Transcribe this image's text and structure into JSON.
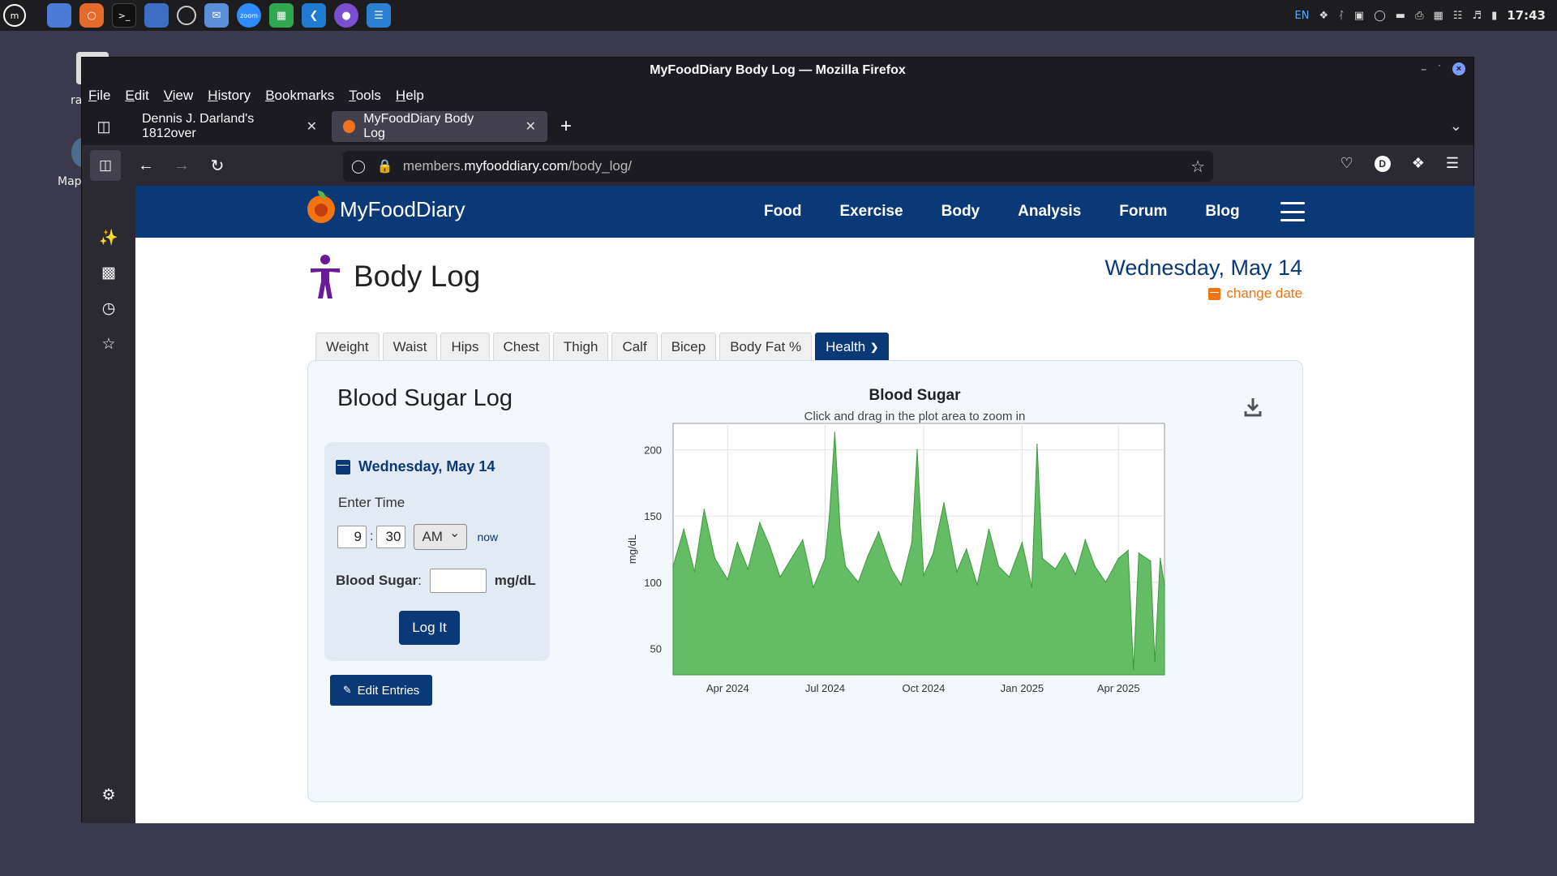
{
  "system_panel": {
    "launcher_icons": [
      "mint-menu-icon",
      "files-icon",
      "firefox-icon",
      "terminal-icon",
      "finder-icon",
      "timeshift-icon",
      "mail-icon",
      "zoom-icon",
      "spreadsheet-icon",
      "vscode-icon",
      "github-icon",
      "notes-icon"
    ],
    "lang": "EN",
    "clock": "17:43"
  },
  "desktop": {
    "item1_label": "ra",
    "item2_label": "Map"
  },
  "window": {
    "title": "MyFoodDiary Body Log — Mozilla Firefox"
  },
  "menu": [
    "File",
    "Edit",
    "View",
    "History",
    "Bookmarks",
    "Tools",
    "Help"
  ],
  "tabs": [
    {
      "label": "Dennis J. Darland's 1812over",
      "active": false
    },
    {
      "label": "MyFoodDiary Body Log",
      "active": true
    }
  ],
  "url": {
    "prefix": "members.",
    "host": "myfooddiary.com",
    "path": "/body_log/"
  },
  "account_initial": "D",
  "site": {
    "logo_text": "MyFoodDiary",
    "nav": [
      "Food",
      "Exercise",
      "Body",
      "Analysis",
      "Forum",
      "Blog"
    ]
  },
  "page": {
    "title": "Body Log",
    "date": "Wednesday, May 14",
    "change_date": "change date",
    "tabs": [
      "Weight",
      "Waist",
      "Hips",
      "Chest",
      "Thigh",
      "Calf",
      "Bicep",
      "Body Fat %",
      "Health"
    ],
    "active_tab": "Health",
    "panel_title": "Blood Sugar Log",
    "form": {
      "date": "Wednesday, May 14",
      "enter_time": "Enter Time",
      "hour": "9",
      "minute": "30",
      "ampm": "AM",
      "now": "now",
      "bs_label": "Blood Sugar",
      "bs_colon": ":",
      "bs_value": "",
      "unit": "mg/dL",
      "log_button": "Log It"
    },
    "edit_entries": "Edit Entries"
  },
  "chart_data": {
    "type": "area",
    "title": "Blood Sugar",
    "subtitle": "Click and drag in the plot area to zoom in",
    "ylabel": "mg/dL",
    "xlabel": "",
    "ylim": [
      30,
      220
    ],
    "yticks": [
      50,
      100,
      150,
      200
    ],
    "x_ticks": [
      "Apr 2024",
      "Jul 2024",
      "Oct 2024",
      "Jan 2025",
      "Apr 2025"
    ],
    "x_range": [
      "2024-02-10",
      "2025-05-14"
    ],
    "color": "#5cb85c",
    "x": [
      "2024-02-10",
      "2024-02-20",
      "2024-03-01",
      "2024-03-10",
      "2024-03-20",
      "2024-04-01",
      "2024-04-10",
      "2024-04-20",
      "2024-05-01",
      "2024-05-10",
      "2024-05-20",
      "2024-06-01",
      "2024-06-10",
      "2024-06-20",
      "2024-07-01",
      "2024-07-05",
      "2024-07-10",
      "2024-07-15",
      "2024-07-20",
      "2024-08-01",
      "2024-08-10",
      "2024-08-20",
      "2024-09-01",
      "2024-09-10",
      "2024-09-20",
      "2024-09-25",
      "2024-10-01",
      "2024-10-10",
      "2024-10-20",
      "2024-11-01",
      "2024-11-10",
      "2024-11-20",
      "2024-12-01",
      "2024-12-10",
      "2024-12-20",
      "2025-01-01",
      "2025-01-10",
      "2025-01-15",
      "2025-01-20",
      "2025-02-01",
      "2025-02-10",
      "2025-02-20",
      "2025-03-01",
      "2025-03-10",
      "2025-03-20",
      "2025-04-01",
      "2025-04-10",
      "2025-04-15",
      "2025-04-20",
      "2025-05-01",
      "2025-05-05",
      "2025-05-10",
      "2025-05-14"
    ],
    "values": [
      112,
      140,
      108,
      155,
      118,
      102,
      130,
      110,
      145,
      128,
      104,
      120,
      132,
      96,
      118,
      150,
      213,
      140,
      112,
      100,
      120,
      138,
      110,
      98,
      130,
      200,
      105,
      122,
      160,
      108,
      125,
      98,
      140,
      112,
      104,
      130,
      96,
      204,
      118,
      110,
      122,
      106,
      132,
      112,
      100,
      118,
      124,
      34,
      122,
      116,
      40,
      118,
      98
    ]
  }
}
